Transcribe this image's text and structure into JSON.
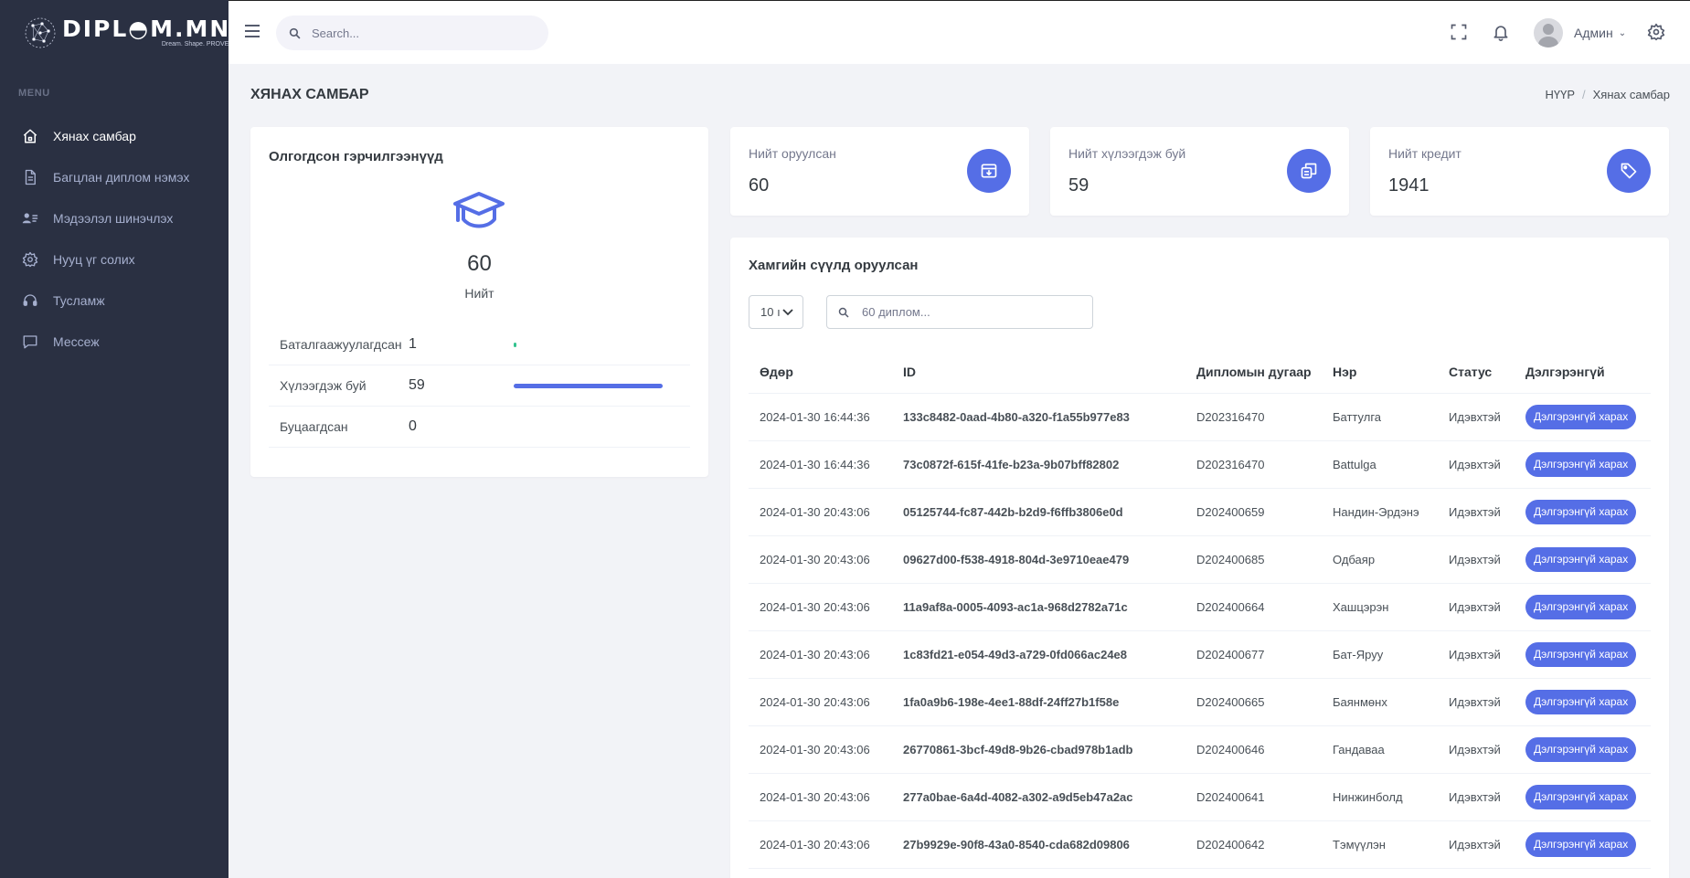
{
  "brand": {
    "name": "DIPL◓M.MN",
    "tagline": "Dream. Shape. PROVE."
  },
  "sidebar": {
    "menu_title": "MENU",
    "items": [
      {
        "label": "Хянах самбар",
        "icon": "home-icon"
      },
      {
        "label": "Багцлан диплом нэмэх",
        "icon": "file-icon"
      },
      {
        "label": "Мэдээлэл шинэчлэх",
        "icon": "user-list-icon"
      },
      {
        "label": "Нууц үг солих",
        "icon": "gear-icon"
      },
      {
        "label": "Тусламж",
        "icon": "headset-icon"
      },
      {
        "label": "Мессеж",
        "icon": "message-icon"
      }
    ]
  },
  "topbar": {
    "search_placeholder": "Search...",
    "user_name": "Админ"
  },
  "page": {
    "title": "ХЯНАХ САМБАР",
    "breadcrumb": [
      "НҮҮР",
      "Хянах самбар"
    ]
  },
  "verification": {
    "title": "Олгогдсон гэрчилгээнүүд",
    "total": "60",
    "total_label": "Нийт",
    "rows": [
      {
        "label": "Баталгаажуулагдсан",
        "value": "1",
        "fraction": 0.017
      },
      {
        "label": "Хүлээгдэж буй",
        "value": "59",
        "fraction": 0.983
      },
      {
        "label": "Буцаагдсан",
        "value": "0",
        "fraction": 0
      }
    ]
  },
  "stats": [
    {
      "label": "Нийт оруулсан",
      "value": "60",
      "icon": "archive-icon"
    },
    {
      "label": "Нийт хүлээгдэж буй",
      "value": "59",
      "icon": "copy-icon"
    },
    {
      "label": "Нийт кредит",
      "value": "1941",
      "icon": "tag-icon"
    }
  ],
  "recent": {
    "title": "Хамгийн сүүлд оруулсан",
    "page_length": "10 ı",
    "search_placeholder": "60 диплом...",
    "columns": [
      "Өдөр",
      "ID",
      "Дипломын дугаар",
      "Нэр",
      "Статус",
      "Дэлгэрэнгүй"
    ],
    "button_label": "Дэлгэрэнгүй харах",
    "rows": [
      {
        "date": "2024-01-30 16:44:36",
        "id": "133c8482-0aad-4b80-a320-f1a55b977e83",
        "number": "D202316470",
        "name": "Баттулга",
        "status": "Идэвхтэй"
      },
      {
        "date": "2024-01-30 16:44:36",
        "id": "73c0872f-615f-41fe-b23a-9b07bff82802",
        "number": "D202316470",
        "name": "Battulga",
        "status": "Идэвхтэй"
      },
      {
        "date": "2024-01-30 20:43:06",
        "id": "05125744-fc87-442b-b2d9-f6ffb3806e0d",
        "number": "D202400659",
        "name": "Нандин-Эрдэнэ",
        "status": "Идэвхтэй"
      },
      {
        "date": "2024-01-30 20:43:06",
        "id": "09627d00-f538-4918-804d-3e9710eae479",
        "number": "D202400685",
        "name": "Одбаяр",
        "status": "Идэвхтэй"
      },
      {
        "date": "2024-01-30 20:43:06",
        "id": "11a9af8a-0005-4093-ac1a-968d2782a71c",
        "number": "D202400664",
        "name": "Хашцэрэн",
        "status": "Идэвхтэй"
      },
      {
        "date": "2024-01-30 20:43:06",
        "id": "1c83fd21-e054-49d3-a729-0fd066ac24e8",
        "number": "D202400677",
        "name": "Бат-Яруу",
        "status": "Идэвхтэй"
      },
      {
        "date": "2024-01-30 20:43:06",
        "id": "1fa0a9b6-198e-4ee1-88df-24ff27b1f58e",
        "number": "D202400665",
        "name": "Баянмөнх",
        "status": "Идэвхтэй"
      },
      {
        "date": "2024-01-30 20:43:06",
        "id": "26770861-3bcf-49d8-9b26-cbad978b1adb",
        "number": "D202400646",
        "name": "Гандаваа",
        "status": "Идэвхтэй"
      },
      {
        "date": "2024-01-30 20:43:06",
        "id": "277a0bae-6a4d-4082-a302-a9d5eb47a2ac",
        "number": "D202400641",
        "name": "Нинжинболд",
        "status": "Идэвхтэй"
      },
      {
        "date": "2024-01-30 20:43:06",
        "id": "27b9929e-90f8-43a0-8540-cda682d09806",
        "number": "D202400642",
        "name": "Тэмүүлэн",
        "status": "Идэвхтэй"
      }
    ]
  },
  "colors": {
    "sidebar_bg": "#2a3042",
    "accent": "#556ee6",
    "page_bg": "#f2f3f7"
  }
}
